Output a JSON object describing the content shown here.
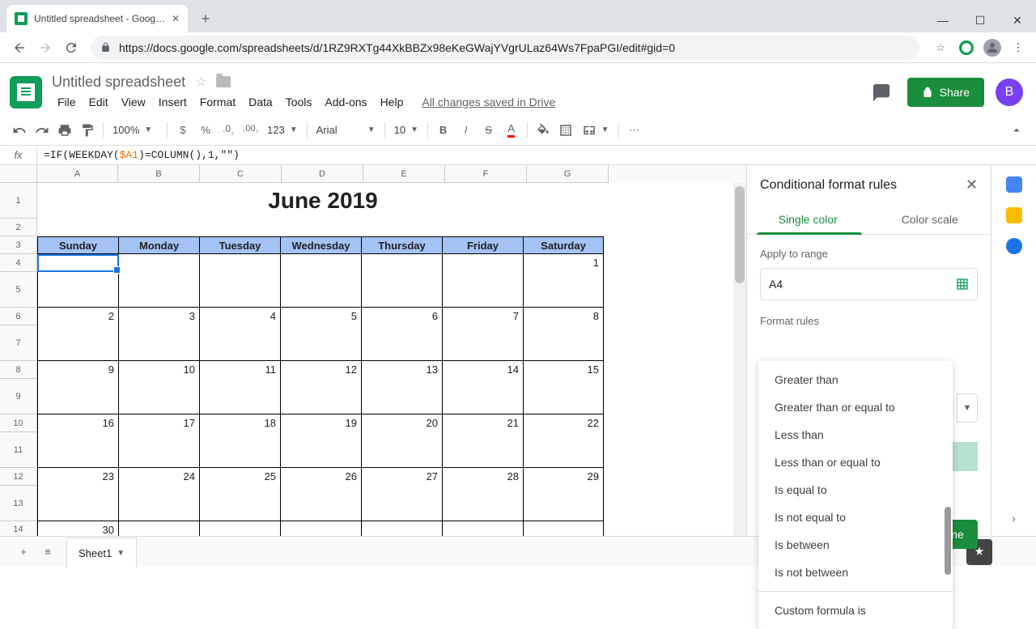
{
  "browser": {
    "tab_title": "Untitled spreadsheet - Google S",
    "url": "https://docs.google.com/spreadsheets/d/1RZ9RXTg44XkBBZx98eKeGWajYVgrULaz64Ws7FpaPGI/edit#gid=0"
  },
  "doc": {
    "title": "Untitled spreadsheet",
    "save_status": "All changes saved in Drive"
  },
  "menus": [
    "File",
    "Edit",
    "View",
    "Insert",
    "Format",
    "Data",
    "Tools",
    "Add-ons",
    "Help"
  ],
  "toolbar": {
    "zoom": "100%",
    "currency": "$",
    "percent": "%",
    "dec_less": ".0",
    "dec_more": ".00",
    "num_fmt": "123",
    "font": "Arial",
    "font_size": "10"
  },
  "formula": {
    "prefix": "=IF(WEEKDAY(",
    "ref": "$A1",
    "suffix": ")=COLUMN(),1,\"\")"
  },
  "columns": [
    "A",
    "B",
    "C",
    "D",
    "E",
    "F",
    "G"
  ],
  "rows": [
    "1",
    "2",
    "3",
    "4",
    "5",
    "6",
    "7",
    "8",
    "9",
    "10",
    "11",
    "12",
    "13",
    "14"
  ],
  "calendar": {
    "title": "June 2019",
    "days": [
      "Sunday",
      "Monday",
      "Tuesday",
      "Wednesday",
      "Thursday",
      "Friday",
      "Saturday"
    ],
    "weeks": [
      [
        "",
        "",
        "",
        "",
        "",
        "",
        "1"
      ],
      [
        "2",
        "3",
        "4",
        "5",
        "6",
        "7",
        "8"
      ],
      [
        "9",
        "10",
        "11",
        "12",
        "13",
        "14",
        "15"
      ],
      [
        "16",
        "17",
        "18",
        "19",
        "20",
        "21",
        "22"
      ],
      [
        "23",
        "24",
        "25",
        "26",
        "27",
        "28",
        "29"
      ],
      [
        "30",
        "",
        "",
        "",
        "",
        "",
        ""
      ]
    ]
  },
  "panel": {
    "title": "Conditional format rules",
    "tab_single": "Single color",
    "tab_scale": "Color scale",
    "apply_label": "Apply to range",
    "range": "A4",
    "rules_label": "Format rules",
    "done": "ne",
    "options": [
      "Greater than",
      "Greater than or equal to",
      "Less than",
      "Less than or equal to",
      "Is equal to",
      "Is not equal to",
      "Is between",
      "Is not between",
      "Custom formula is"
    ]
  },
  "sheet_tab": "Sheet1",
  "avatar_letter": "B"
}
